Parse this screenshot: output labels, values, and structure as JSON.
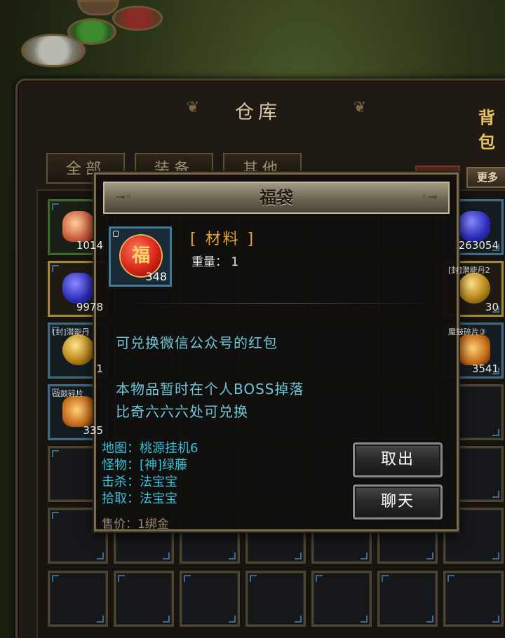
{
  "warehouse": {
    "title": "仓库",
    "bag_tab": "背包",
    "tabs": [
      "全部",
      "装备",
      "其他"
    ],
    "more_button": "更多"
  },
  "grid": {
    "slots": [
      {
        "art": "ingot",
        "count": "1014",
        "name": "",
        "style": "green"
      },
      {
        "art": "potion",
        "count": "263054",
        "name": "",
        "style": "blue"
      },
      {
        "art": "potion",
        "count": "9978",
        "name": "",
        "style": "gold"
      },
      {
        "art": "orb",
        "count": "30",
        "name": "[封]潜能丹2",
        "style": "gold"
      },
      {
        "art": "orb",
        "count": "1",
        "name": "[封]潜能丹",
        "style": "blue"
      },
      {
        "art": "shard",
        "count": "3541",
        "name": "魔鼓碎片③",
        "style": "blue"
      },
      {
        "art": "shard",
        "count": "335",
        "name": "战鼓碎片",
        "style": "blue"
      }
    ]
  },
  "dialog": {
    "title": "福袋",
    "item_icon_glyph": "福",
    "item_quantity": "348",
    "category": "[ 材料 ]",
    "weight_label": "重量：",
    "weight_value": "1",
    "description": [
      "可兑换微信公众号的红包",
      "本物品暂时在个人BOSS掉落",
      "比奇六六六处可兑换"
    ],
    "drop_info": {
      "map": "地图：桃源挂机6",
      "monster": "怪物：[神]绿藤",
      "kill": "击杀：法宝宝",
      "loot": "拾取：法宝宝"
    },
    "sell_price": "售价：1绑金",
    "buttons": {
      "withdraw": "取出",
      "chat": "聊天"
    }
  },
  "colors": {
    "category": "#e2a33a",
    "description": "#6fc6d6",
    "drop_info": "#37c0d8",
    "sell_price": "#9a8a72"
  }
}
